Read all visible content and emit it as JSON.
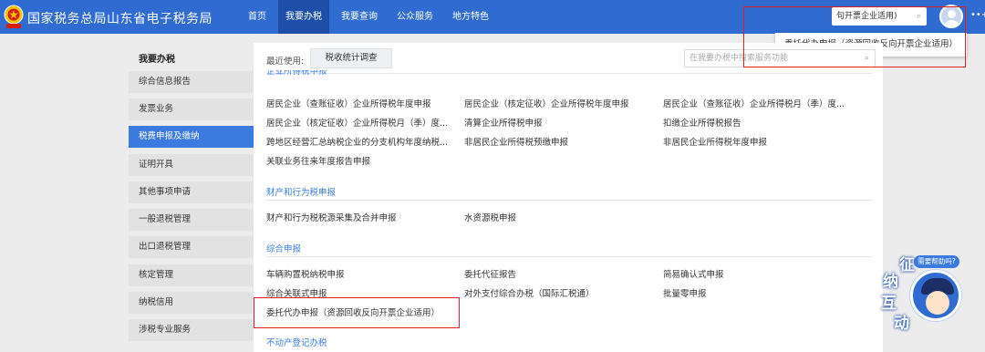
{
  "header": {
    "site_title": "国家税务总局山东省电子税务局",
    "nav": [
      "首页",
      "我要办税",
      "我要查询",
      "公众服务",
      "地方特色"
    ],
    "active_nav": "我要办税",
    "search_value": "句开票企业适用)",
    "more_label": "+",
    "brand_color": "#2f6bd0"
  },
  "dropdown": {
    "items": [
      "委托代办申报（资源回收反向开票企业适用）"
    ]
  },
  "sidebar": {
    "title": "我要办税",
    "items": [
      {
        "label": "综合信息报告"
      },
      {
        "label": "发票业务"
      },
      {
        "label": "税费申报及缴纳"
      },
      {
        "label": "证明开具"
      },
      {
        "label": "其他事项申请"
      },
      {
        "label": "一般退税管理"
      },
      {
        "label": "出口退税管理"
      },
      {
        "label": "核定管理"
      },
      {
        "label": "纳税信用"
      },
      {
        "label": "涉税专业服务"
      }
    ],
    "active": "税费申报及缴纳"
  },
  "main": {
    "recent_label": "最近使用:",
    "recent_items": [
      "税收统计调查"
    ],
    "search_placeholder": "在我要办税中搜索服务功能",
    "cut_heading": "企业所得税申报",
    "sections": [
      {
        "items": [
          "居民企业（查账征收）企业所得税年度申报",
          "居民企业（核定征收）企业所得税年度申报",
          "居民企业（查账征收）企业所得税月（季）度...",
          "居民企业（核定征收）企业所得税月（季）度...",
          "清算企业所得税申报",
          "扣缴企业所得税报告",
          "跨地区经营汇总纳税企业的分支机构年度纳税...",
          "非居民企业所得税预缴申报",
          "非居民企业所得税年度申报",
          "关联业务往来年度报告申报"
        ]
      },
      {
        "title": "财产和行为税申报",
        "items": [
          "财产和行为税税源采集及合并申报",
          "水资源税申报"
        ]
      },
      {
        "title": "综合申报",
        "items": [
          "车辆购置税纳税申报",
          "委托代征报告",
          "简易确认式申报",
          "综合关联式申报",
          "对外支付综合办税（国际汇税通）",
          "批量零申报",
          "委托代办申报（资源回收反向开票企业适用）"
        ]
      },
      {
        "title": "不动产登记办税"
      }
    ]
  },
  "assistant": {
    "bubble": "需要帮助吗?",
    "chars": [
      "征",
      "纳",
      "互",
      "动"
    ]
  },
  "colors": {
    "accent": "#3b7be0",
    "highlight": "#e02020"
  }
}
